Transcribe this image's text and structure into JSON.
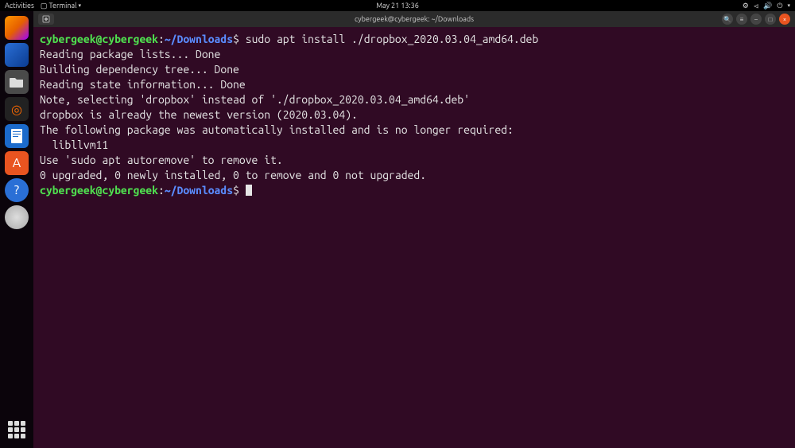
{
  "topbar": {
    "activities": "Activities",
    "app_name": "Terminal",
    "datetime": "May 21  13:36"
  },
  "titlebar": {
    "title": "cybergeek@cybergeek: ~/Downloads"
  },
  "prompt": {
    "userhost": "cybergeek@cybergeek",
    "path": "~/Downloads",
    "symbol": "$"
  },
  "terminal_output": {
    "command": "sudo apt install ./dropbox_2020.03.04_amd64.deb",
    "lines": [
      "Reading package lists... Done",
      "Building dependency tree... Done",
      "Reading state information... Done",
      "Note, selecting 'dropbox' instead of './dropbox_2020.03.04_amd64.deb'",
      "dropbox is already the newest version (2020.03.04).",
      "The following package was automatically installed and is no longer required:",
      "  libllvm11",
      "Use 'sudo apt autoremove' to remove it.",
      "0 upgraded, 0 newly installed, 0 to remove and 0 not upgraded."
    ]
  },
  "dock": {
    "items": [
      {
        "name": "firefox-icon"
      },
      {
        "name": "thunderbird-icon"
      },
      {
        "name": "files-icon"
      },
      {
        "name": "rhythmbox-icon"
      },
      {
        "name": "libreoffice-writer-icon"
      },
      {
        "name": "ubuntu-software-icon"
      },
      {
        "name": "help-icon"
      },
      {
        "name": "terminal-icon"
      },
      {
        "name": "disc-icon"
      }
    ]
  },
  "glyphs": {
    "menu_square": "▢",
    "search": "🔍",
    "burger": "≡",
    "minimize": "–",
    "maximize": "□",
    "close": "×",
    "help": "?",
    "term": ">_",
    "net": "⚙",
    "a11y": "⏿",
    "vol": "🔊",
    "power": "⏻",
    "arrow_down": "▾"
  }
}
